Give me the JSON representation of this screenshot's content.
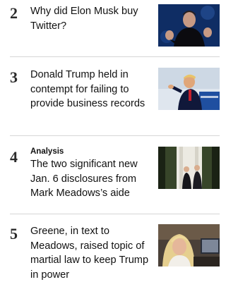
{
  "items": [
    {
      "rank": "2",
      "label": "",
      "headline": "Why did Elon Musk buy Twitter?",
      "image": "photo-man-gesturing-dark-blue"
    },
    {
      "rank": "3",
      "label": "",
      "headline": "Donald Trump held in contempt for failing to provide business records",
      "image": "photo-man-pointing-podium-blue"
    },
    {
      "rank": "4",
      "label": "Analysis",
      "headline": "The two significant new Jan. 6 disclosures from Mark Meadows’s aide",
      "image": "photo-two-men-white-house-colonnade"
    },
    {
      "rank": "5",
      "label": "",
      "headline": "Greene, in text to Meadows, raised topic of martial law to keep Trump in power",
      "image": "photo-woman-blonde-hearing-room"
    }
  ],
  "colors": {
    "divider": "#d6d6d6",
    "text": "#111111",
    "rank": "#2a2a2a"
  }
}
